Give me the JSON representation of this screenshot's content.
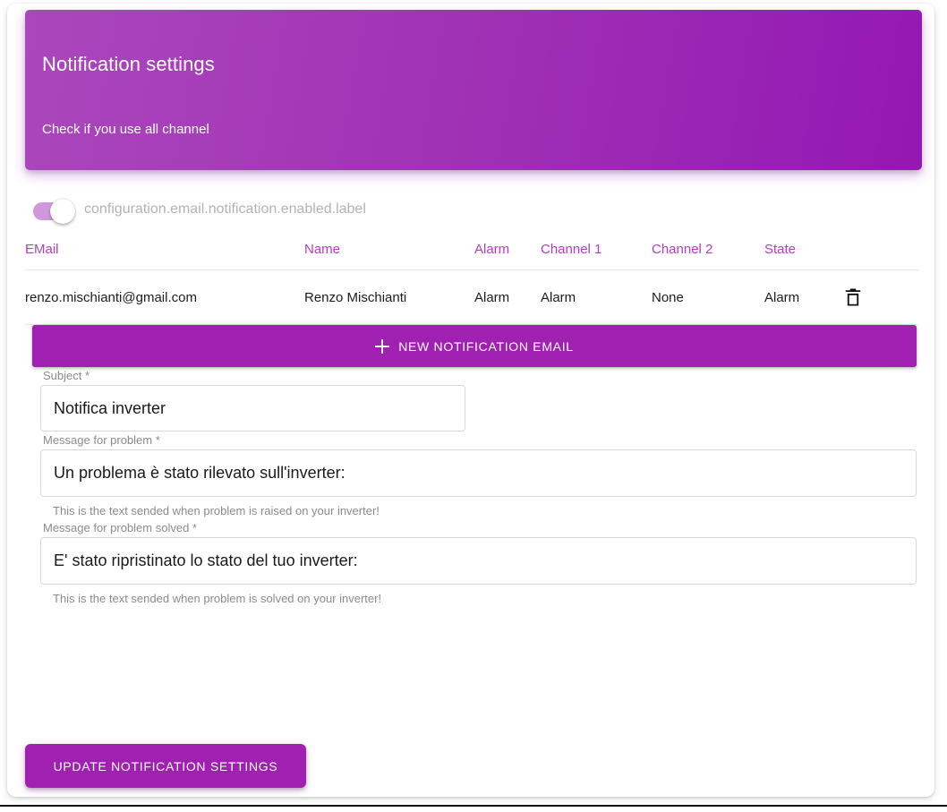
{
  "hero": {
    "title": "Notification settings",
    "subtitle": "Check if you use all channel"
  },
  "toggle": {
    "label": "configuration.email.notification.enabled.label",
    "state": "on"
  },
  "table": {
    "headers": [
      "EMail",
      "Name",
      "Alarm",
      "Channel 1",
      "Channel 2",
      "State",
      ""
    ],
    "rows": [
      {
        "email": "renzo.mischianti@gmail.com",
        "name": "Renzo Mischianti",
        "alarm": "Alarm",
        "channel1": "Alarm",
        "channel2": "None",
        "state": "Alarm",
        "delete_icon": "trash-icon"
      }
    ]
  },
  "new_email_button": {
    "label": "NEW NOTIFICATION EMAIL",
    "icon": "plus-icon"
  },
  "form": {
    "subject": {
      "label": "Subject *",
      "value": "Notifica inverter",
      "placeholder": ""
    },
    "message_problem": {
      "label": "Message for problem *",
      "value": "Un problema è stato rilevato sull'inverter:",
      "placeholder": "",
      "helper": "This is the text sended when problem is raised on your inverter!"
    },
    "message_solved": {
      "label": "Message for problem solved *",
      "value": "E' stato ripristinato lo stato del tuo inverter:",
      "placeholder": "",
      "helper": "This is the text sended when problem is solved on your inverter!"
    }
  },
  "update_button": {
    "label": "UPDATE NOTIFICATION SETTINGS"
  },
  "colors": {
    "accent": "#a020b2",
    "hero_gradient_start": "#ab47bc",
    "hero_gradient_end": "#9418b3",
    "table_header": "#b43cc4",
    "muted_text": "#8b8b8b"
  }
}
